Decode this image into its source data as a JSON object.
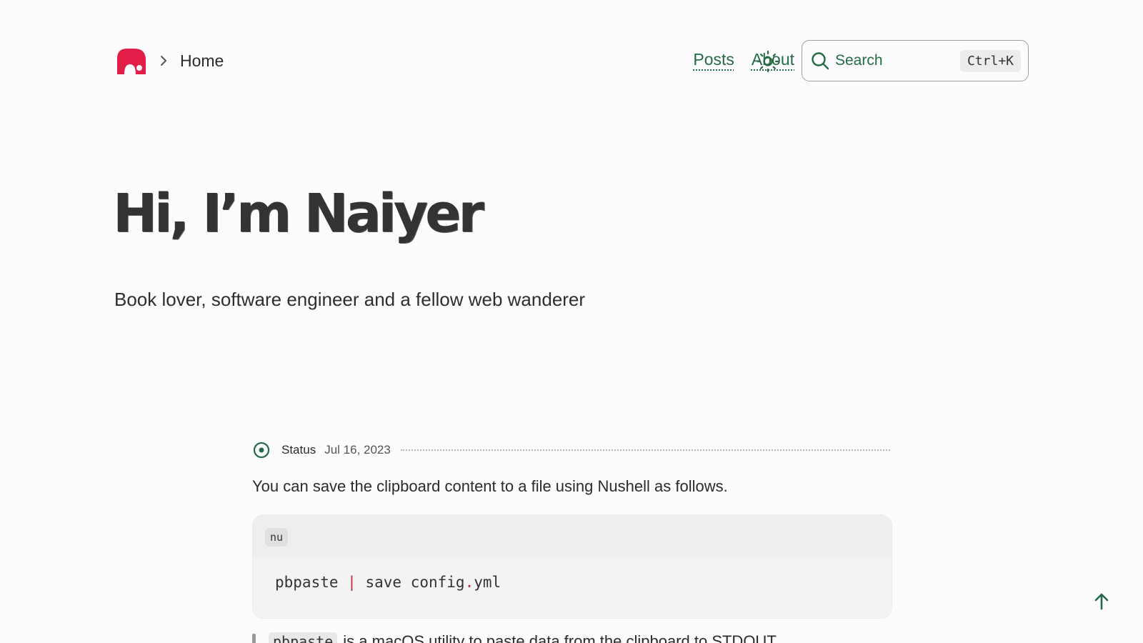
{
  "header": {
    "breadcrumb": "Home",
    "nav": [
      {
        "label": "Posts"
      },
      {
        "label": "About"
      }
    ],
    "search": {
      "placeholder": "Search",
      "shortcut": "Ctrl+K"
    }
  },
  "hero": {
    "title": "Hi, I’m Naiyer",
    "subtitle": "Book lover, software engineer and a fellow web wanderer"
  },
  "status": {
    "label": "Status",
    "date": "Jul 16, 2023",
    "text": "You can save the clipboard content to a file using Nushell as follows.",
    "code": {
      "lang": "nu",
      "cmd": "pbpaste",
      "pipe": "|",
      "rest1": "save config",
      "dot": ".",
      "rest2": "yml"
    },
    "note_code": "pbpaste",
    "note_text": "is a macOS utility to paste data from the clipboard to STDOUT."
  },
  "icons": {
    "logo": "logo-icon",
    "breadcrumb_separator": "chevron-right-icon",
    "theme": "sun-icon",
    "search": "search-icon",
    "status": "status-circle-icon",
    "back_to_top": "arrow-up-icon"
  },
  "colors": {
    "brand": "#e11d48",
    "accent": "#256b44",
    "background": "#fcfbfd",
    "code_operator": "#c0303a"
  }
}
